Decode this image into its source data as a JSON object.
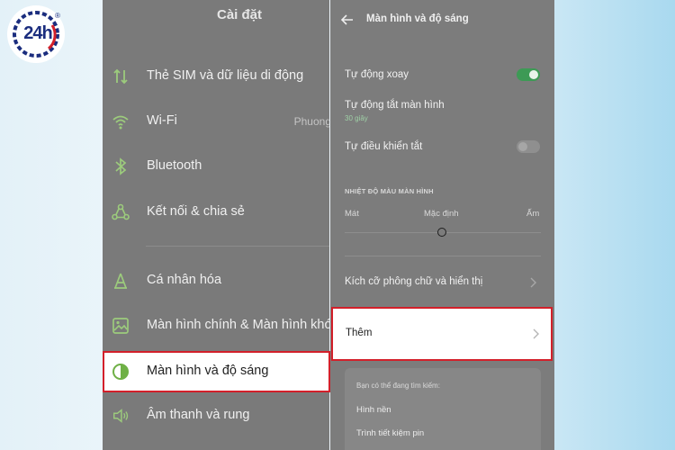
{
  "logo": {
    "text": "24h",
    "reg": "®"
  },
  "left_panel": {
    "title": "Cài đặt",
    "items": [
      {
        "icon": "sim-data-icon",
        "label": "Thẻ SIM và dữ liệu di động",
        "value": ""
      },
      {
        "icon": "wifi-icon",
        "label": "Wi-Fi",
        "value": "Phuong"
      },
      {
        "icon": "bluetooth-icon",
        "label": "Bluetooth",
        "value": ""
      },
      {
        "icon": "connection-share-icon",
        "label": "Kết nối & chia sẻ",
        "value": ""
      },
      {
        "icon": "personalize-icon",
        "label": "Cá nhân hóa",
        "value": ""
      },
      {
        "icon": "home-screen-icon",
        "label": "Màn hình chính & Màn hình khóa",
        "value": ""
      },
      {
        "icon": "brightness-icon",
        "label": "Màn hình và độ sáng",
        "value": ""
      },
      {
        "icon": "sound-icon",
        "label": "Âm thanh và rung",
        "value": ""
      }
    ]
  },
  "right_panel": {
    "title": "Màn hình và độ sáng",
    "auto_rotate": {
      "label": "Tự động xoay",
      "on": true
    },
    "screen_timeout": {
      "label": "Tự động tắt màn hình",
      "value": "30 giây"
    },
    "auto_off_control": {
      "label": "Tự điều khiển tắt",
      "on": false
    },
    "color_temp": {
      "heading": "NHIỆT ĐỘ MÀU MÀN HÌNH",
      "cool": "Mát",
      "default": "Mặc định",
      "warm": "Ấm"
    },
    "font_size": {
      "label": "Kích cỡ phông chữ và hiển thị"
    },
    "more": {
      "label": "Thêm"
    },
    "suggest": {
      "heading": "Bạn có thể đang tìm kiếm:",
      "items": [
        "Hình nền",
        "Trình tiết kiệm pin"
      ]
    }
  },
  "colors": {
    "highlight_border": "#d3202a",
    "accent_green": "#3d9a55",
    "icon_green": "#9ccb7c"
  }
}
